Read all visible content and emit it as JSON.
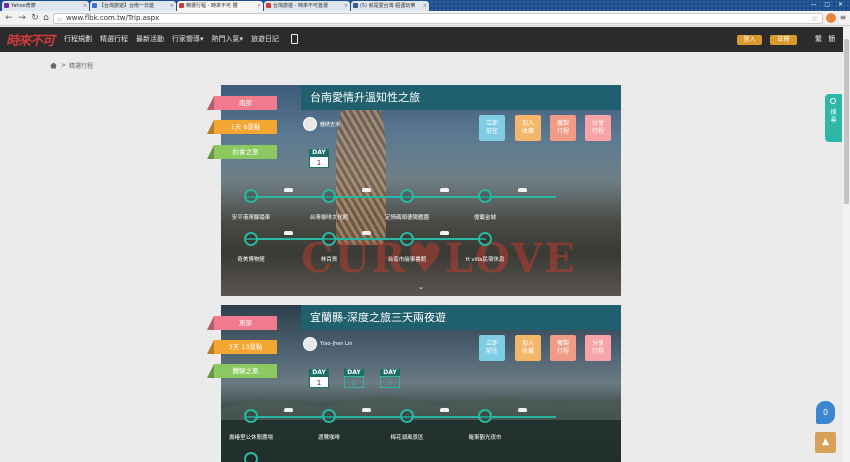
{
  "browser": {
    "tabs": [
      {
        "label": "Yahoo奇摩",
        "color": "#6b2fb4"
      },
      {
        "label": "【台灣旅遊】台南一日遊",
        "color": "#3a6fd8"
      },
      {
        "label": "精選行程 - 時來不可 攫",
        "color": "#d23b3b"
      },
      {
        "label": "台灣旅遊 - 時來不可首選",
        "color": "#d23b3b"
      },
      {
        "label": "(5) 就是愛台灣 超遇玩樂",
        "color": "#3b5998"
      }
    ],
    "url": "www.flbk.com.tw/Trip.aspx",
    "window_controls": "— ▢ ✕"
  },
  "header": {
    "logo": "時來不可",
    "nav": [
      "行程規劃",
      "精選行程",
      "最新活動",
      "行家嚮導▾",
      "熱門入氣▾",
      "旅遊日記"
    ],
    "login": "登入",
    "register": "註冊",
    "lang": "繁 簡"
  },
  "breadcrumb": {
    "separator": ">",
    "current": "精選行程"
  },
  "search_tab": "搜尋",
  "chat_badge": "0",
  "trips": [
    {
      "tags": {
        "region": "南部",
        "duration": "1天 8景點",
        "theme": "約會之旅"
      },
      "title": "台南愛情升溫知性之旅",
      "author": "鍾綉吉米",
      "actions": [
        "立即前往",
        "加入收藏",
        "複製行程",
        "分享行程"
      ],
      "days": [
        "1"
      ],
      "stops_row1": [
        "安平港灣腳踏車",
        "台灣咖啡文化館",
        "定情碼頭德陽艦園",
        "億載金城"
      ],
      "stops_row2": [
        "奇美博物館",
        "林百貨",
        "台南市繪事書館",
        "H villa民宿休息"
      ]
    },
    {
      "tags": {
        "region": "東部",
        "duration": "3天 13景點",
        "theme": "體驗之旅"
      },
      "title": "宜蘭縣-深度之旅三天兩夜遊",
      "author": "Yiao-Jhen Lin",
      "actions": [
        "立即前往",
        "加入收藏",
        "複製行程",
        "分享行程"
      ],
      "days": [
        "1",
        "2",
        "3"
      ],
      "stops_row1": [
        "壽椿里公休閒農場",
        "渡鷺咖啡",
        "梅花湖風景區",
        "羅東觀光夜市"
      ]
    }
  ],
  "colors": {
    "accent": "#29b6a2",
    "title_band": "#1f5f6e",
    "header": "#2b2b2b"
  }
}
